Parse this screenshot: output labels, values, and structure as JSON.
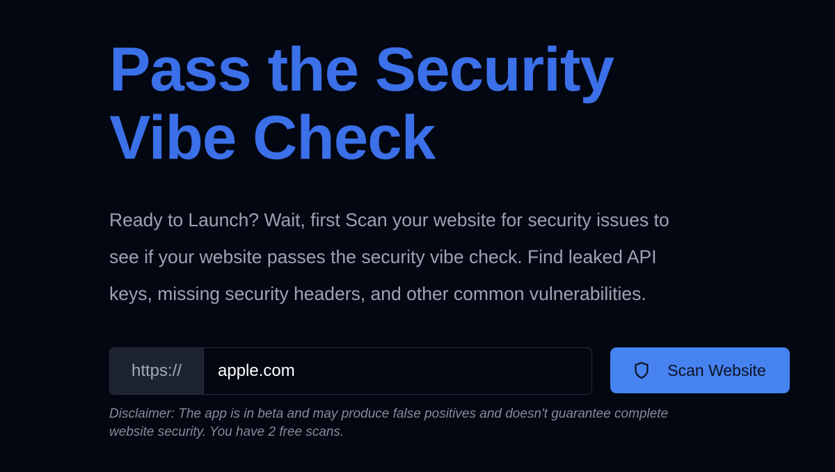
{
  "hero": {
    "title_line1": "Pass the Security",
    "title_line2": "Vibe Check",
    "description_line1": "Ready to Launch? Wait, first Scan your website for security issues to",
    "description_line2": "see if your website passes the security vibe check. Find leaked API",
    "description_line3": "keys, missing security headers, and other common vulnerabilities."
  },
  "scan_form": {
    "url_prefix": "https://",
    "url_value": "apple.com",
    "button_label": "Scan Website",
    "button_icon": "shield-icon"
  },
  "disclaimer": {
    "line1": "Disclaimer: The app is in beta and may produce false positives and doesn't guarantee complete",
    "line2": "website security. You have 2 free scans."
  },
  "colors": {
    "background": "#030712",
    "accent": "#3b70e9",
    "button": "#4682f0",
    "text_muted": "#9ea3b2"
  }
}
